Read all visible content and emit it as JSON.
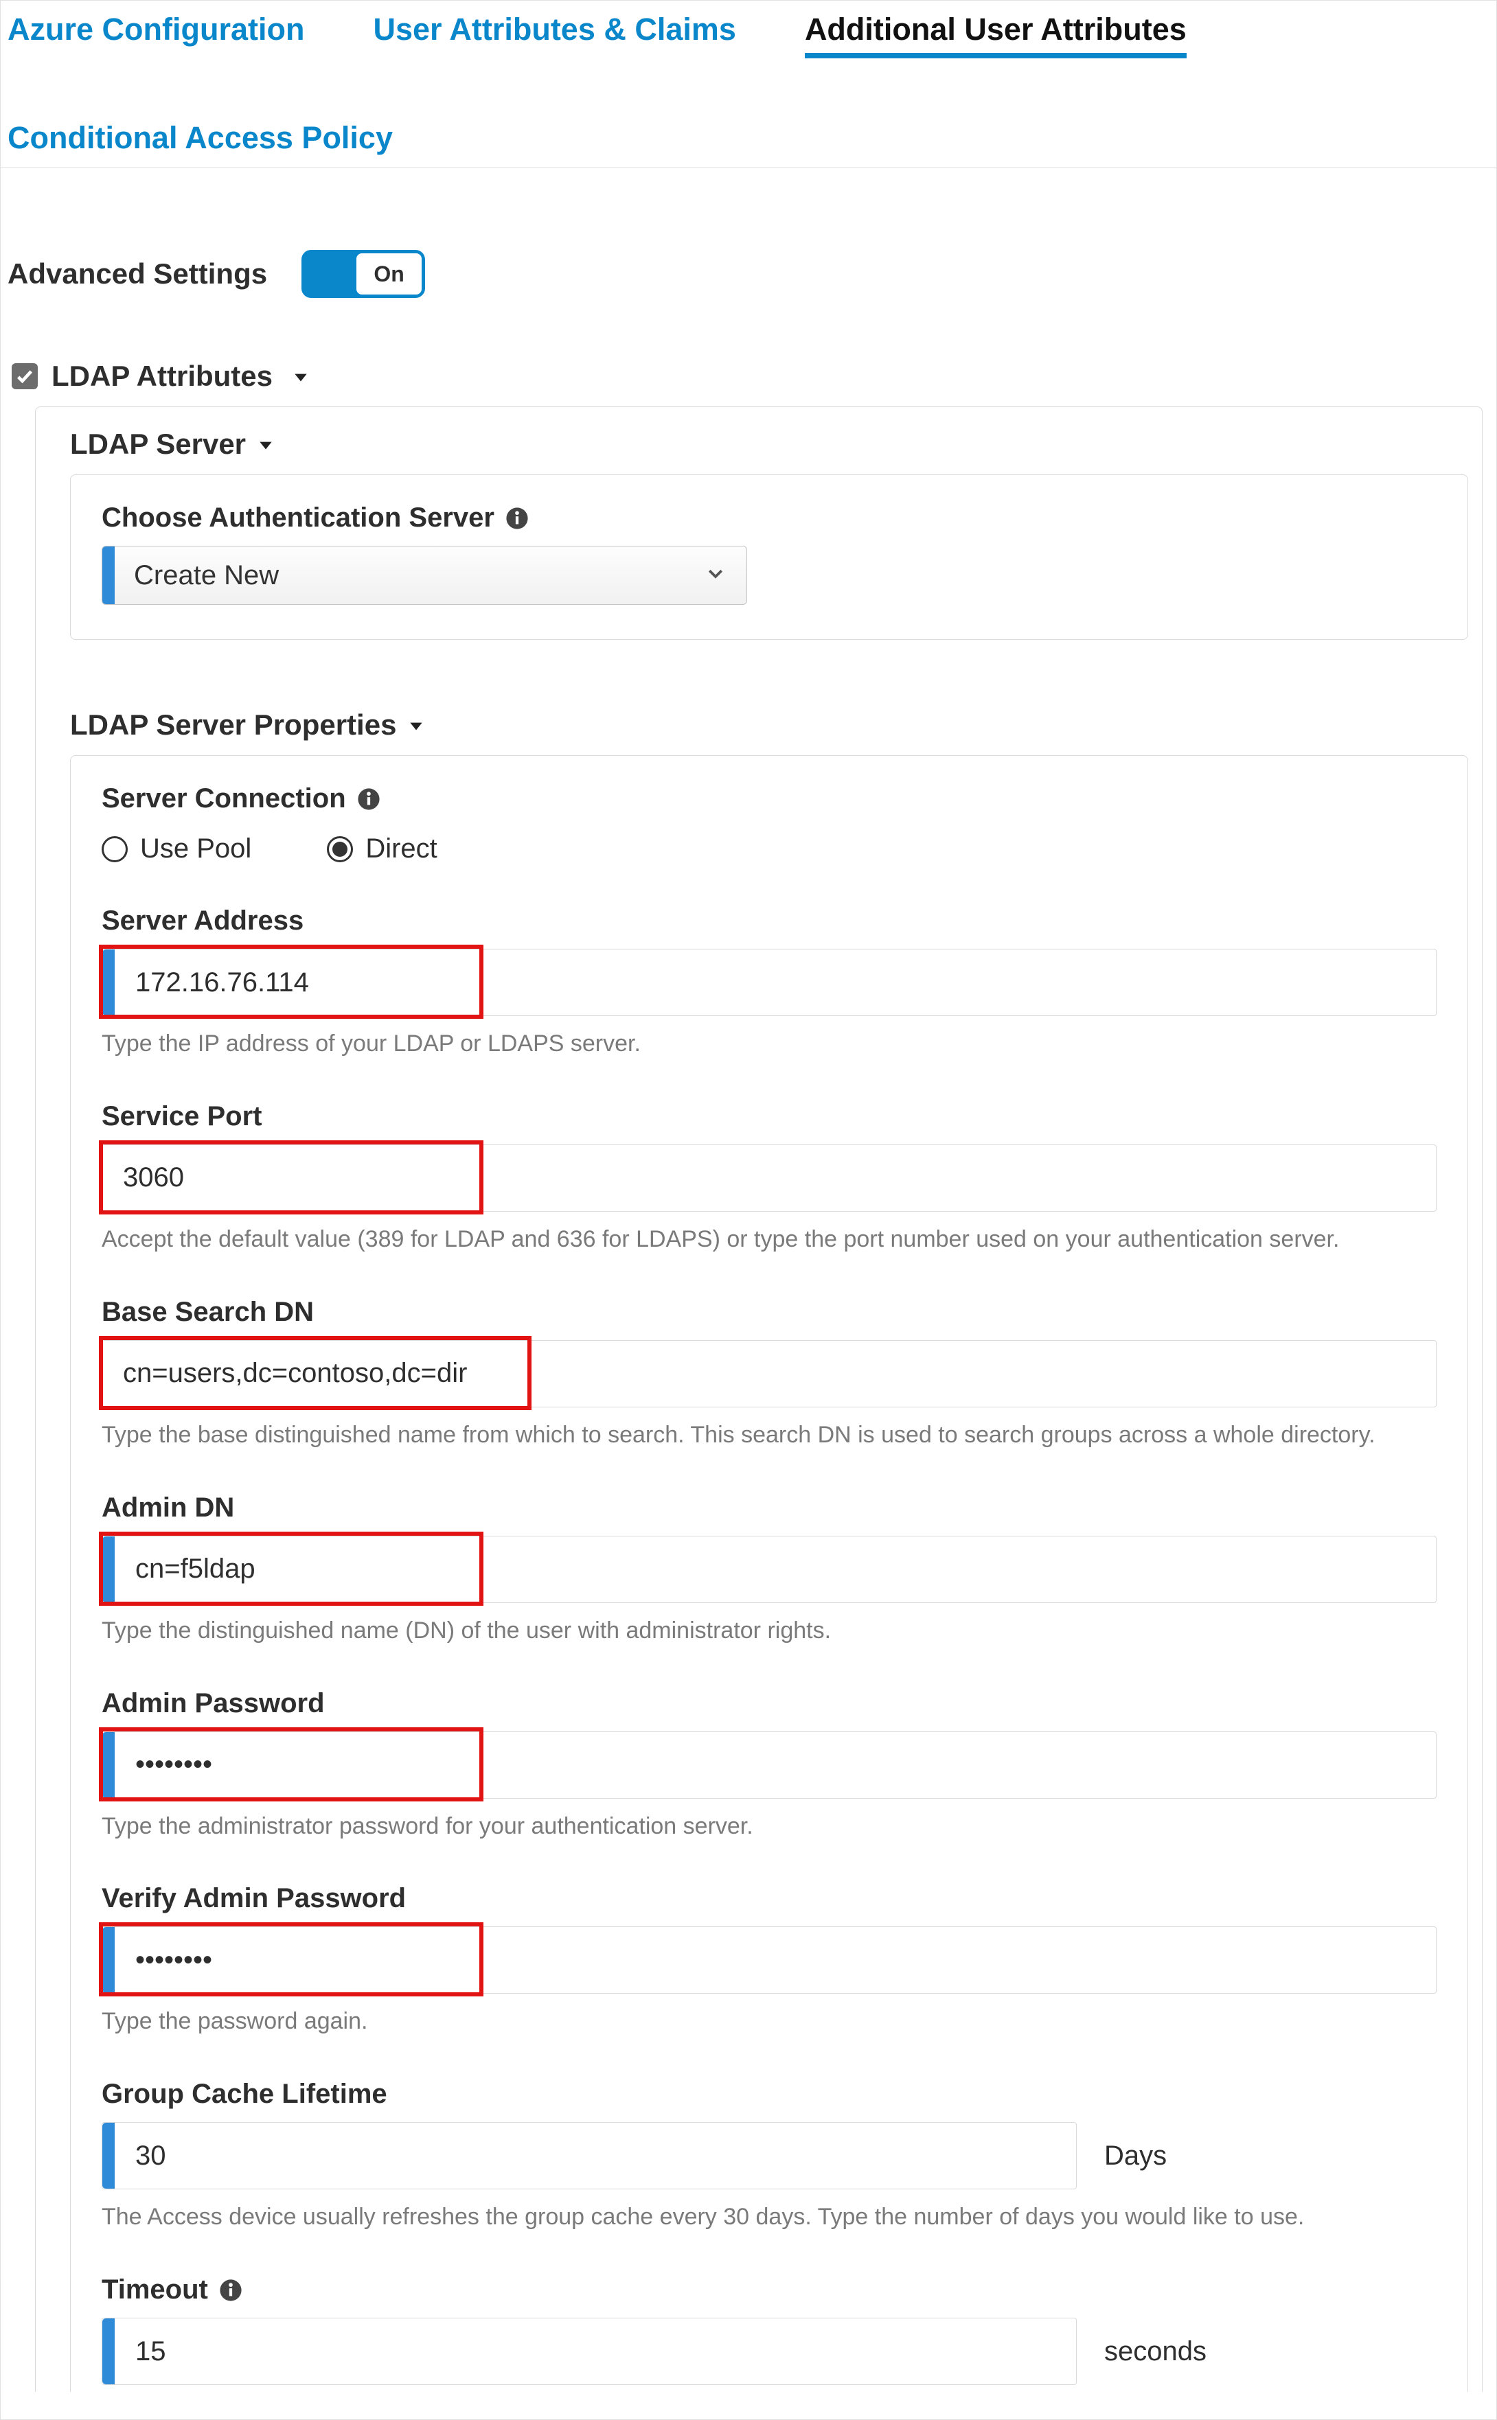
{
  "tabs": {
    "azure": "Azure Configuration",
    "claims": "User Attributes & Claims",
    "additional": "Additional User Attributes",
    "conditional": "Conditional Access Policy"
  },
  "advanced": {
    "label": "Advanced Settings",
    "toggle": "On"
  },
  "ldap_attributes": {
    "header": "LDAP Attributes",
    "server_header": "LDAP Server",
    "choose_auth_label": "Choose Authentication Server",
    "choose_auth_value": "Create New",
    "props_header": "LDAP Server Properties",
    "server_connection": {
      "label": "Server Connection",
      "use_pool": "Use Pool",
      "direct": "Direct",
      "selected": "direct"
    },
    "fields": {
      "server_address": {
        "label": "Server Address",
        "value": "172.16.76.114",
        "hint": "Type the IP address of your LDAP or LDAPS server."
      },
      "service_port": {
        "label": "Service Port",
        "value": "3060",
        "hint": "Accept the default value (389 for LDAP and 636 for LDAPS) or type the port number used on your authentication server."
      },
      "base_dn": {
        "label": "Base Search DN",
        "value": "cn=users,dc=contoso,dc=dir",
        "hint": "Type the base distinguished name from which to search. This search DN is used to search groups across a whole directory."
      },
      "admin_dn": {
        "label": "Admin DN",
        "value": "cn=f5ldap",
        "hint": "Type the distinguished name (DN) of the user with administrator rights."
      },
      "admin_pw": {
        "label": "Admin Password",
        "value": "••••••••",
        "hint": "Type the administrator password for your authentication server."
      },
      "verify_pw": {
        "label": "Verify Admin Password",
        "value": "••••••••",
        "hint": "Type the password again."
      },
      "group_cache": {
        "label": "Group Cache Lifetime",
        "value": "30",
        "suffix": "Days",
        "hint": "The Access device usually refreshes the group cache every 30 days. Type the number of days you would like to use."
      },
      "timeout": {
        "label": "Timeout",
        "value": "15",
        "suffix": "seconds"
      }
    }
  }
}
